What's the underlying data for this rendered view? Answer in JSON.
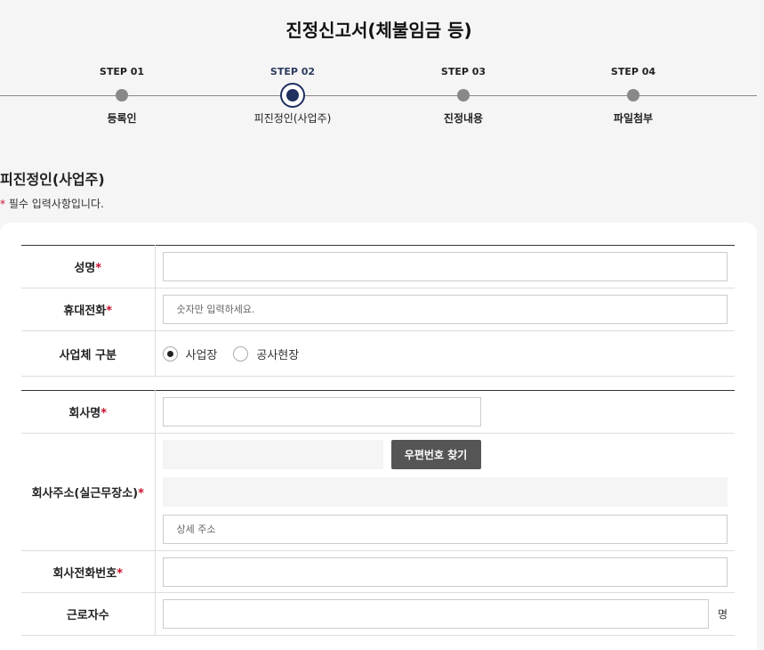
{
  "title": "진정신고서(체불임금 등)",
  "steps": [
    {
      "num": "STEP 01",
      "label": "등록인"
    },
    {
      "num": "STEP 02",
      "label": "피진정인(사업주)"
    },
    {
      "num": "STEP 03",
      "label": "진정내용"
    },
    {
      "num": "STEP 04",
      "label": "파일첨부"
    }
  ],
  "section": {
    "title": "피진정인(사업주)",
    "required_mark": "*",
    "required_note": " 필수 입력사항입니다."
  },
  "form": {
    "name_label": "성명",
    "phone_label": "휴대전화",
    "phone_placeholder": "숫자만 입력하세요.",
    "biz_type_label": "사업체 구분",
    "biz_type_options": [
      "사업장",
      "공사현장"
    ],
    "biz_type_selected": "사업장",
    "company_label": "회사명",
    "address_label": "회사주소(실근무장소)",
    "zip_button": "우편번호 찾기",
    "detail_placeholder": "상세 주소",
    "company_phone_label": "회사전화번호",
    "workers_label": "근로자수",
    "workers_unit": "명",
    "required_mark": "*"
  },
  "colors": {
    "accent": "#1f3060",
    "required": "#c8102e",
    "button": "#555555"
  }
}
